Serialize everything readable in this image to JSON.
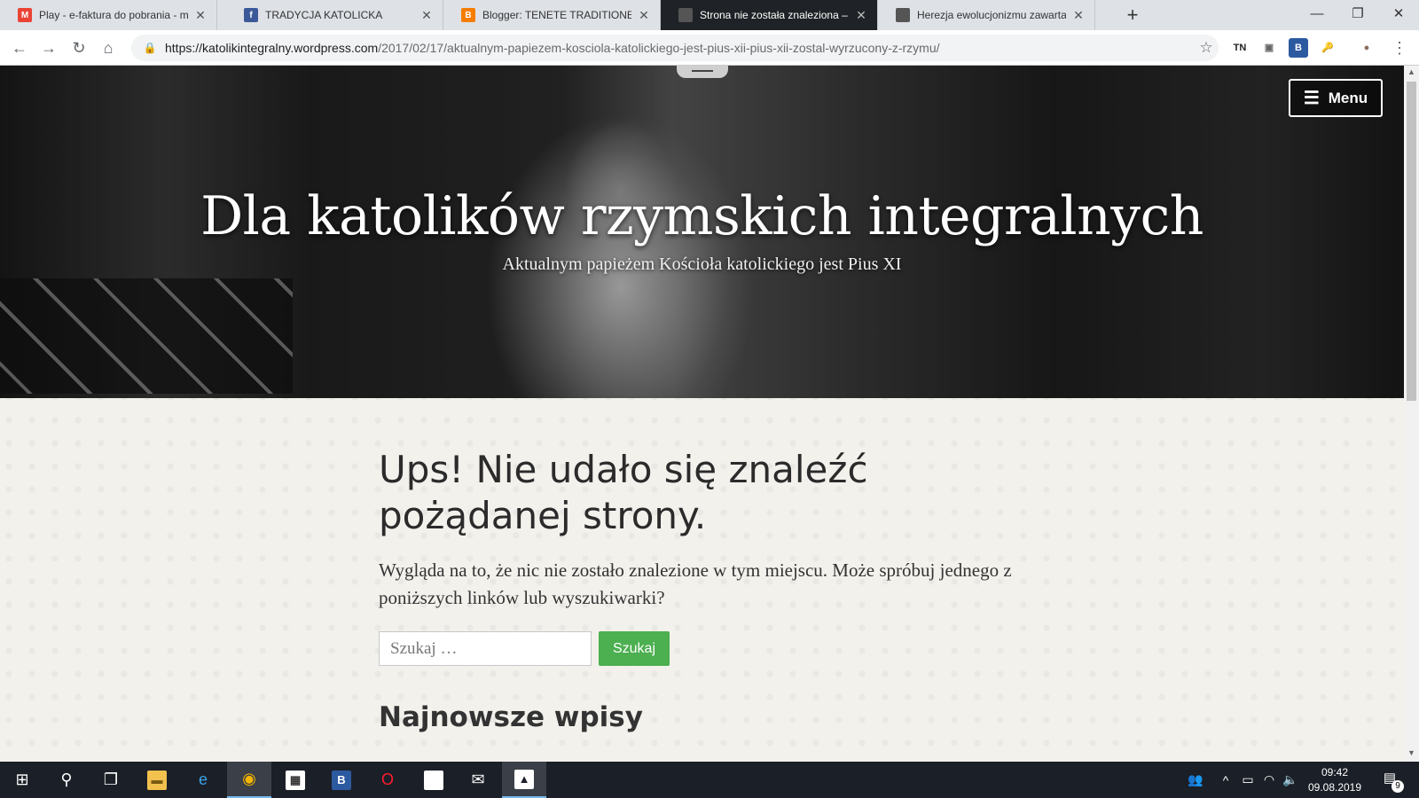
{
  "browser": {
    "tabs": [
      {
        "title": "Play - e-faktura do pobrania - m",
        "favicon": "gmail-icon",
        "favicon_color": "#ea4335",
        "favicon_glyph": "M",
        "active": false
      },
      {
        "title": "TRADYCJA KATOLICKA",
        "favicon": "facebook-icon",
        "favicon_color": "#3b5998",
        "favicon_glyph": "f",
        "active": false
      },
      {
        "title": "Blogger: TENETE TRADITIONES -",
        "favicon": "blogger-icon",
        "favicon_color": "#f57d00",
        "favicon_glyph": "B",
        "active": false
      },
      {
        "title": "Strona nie została znaleziona – D",
        "favicon": "site-icon",
        "favicon_color": "#555555",
        "favicon_glyph": "",
        "active": true
      },
      {
        "title": "Herezja ewolucjonizmu zawarta w",
        "favicon": "site-icon",
        "favicon_color": "#555555",
        "favicon_glyph": "",
        "active": false
      }
    ],
    "new_tab_glyph": "+",
    "window_controls": {
      "minimize": "—",
      "restore": "❐",
      "close": "✕"
    },
    "url_host": "https://katolikintegralny.wordpress.com",
    "url_path": "/2017/02/17/aktualnym-papiezem-kosciola-katolickiego-jest-pius-xii-pius-xii-zostal-wyrzucony-z-rzymu/",
    "extensions": [
      {
        "name": "tn-extension-icon",
        "label": "TN",
        "bg": "#ffffff",
        "fg": "#222222"
      },
      {
        "name": "image-extension-icon",
        "label": "▣",
        "bg": "#ffffff",
        "fg": "#666666"
      },
      {
        "name": "b-extension-icon",
        "label": "B",
        "bg": "#2c5aa0",
        "fg": "#ffffff"
      },
      {
        "name": "key-extension-icon",
        "label": "🔑",
        "bg": "#ffffff",
        "fg": "#e8a000"
      },
      {
        "name": "profile-avatar-icon",
        "label": "●",
        "bg": "#ffffff",
        "fg": "#8a6d5a"
      }
    ]
  },
  "page": {
    "menu_label": "Menu",
    "site_title": "Dla katolików rzymskich integralnych",
    "site_description": "Aktualnym papieżem Kościoła katolickiego jest Pius XI",
    "error_title": "Ups! Nie udało się znaleźć pożądanej strony.",
    "error_text": "Wygląda na to, że nic nie zostało znalezione w tym miejscu. Może spróbuj jednego z poniższych linków lub wyszukiwarki?",
    "search_placeholder": "Szukaj …",
    "search_button": "Szukaj",
    "recent_posts_title": "Najnowsze wpisy"
  },
  "taskbar": {
    "apps": [
      {
        "name": "start-button",
        "glyph": "⊞",
        "bg": "",
        "fg": "#ffffff",
        "active": false
      },
      {
        "name": "search-icon",
        "glyph": "⚲",
        "bg": "",
        "fg": "#ffffff",
        "active": false
      },
      {
        "name": "task-view-icon",
        "glyph": "❐",
        "bg": "",
        "fg": "#ffffff",
        "active": false
      },
      {
        "name": "file-explorer-icon",
        "glyph": "▬",
        "bg": "#f2c14e",
        "fg": "#7a5a10",
        "active": false
      },
      {
        "name": "edge-icon",
        "glyph": "e",
        "bg": "",
        "fg": "#3ba3e8",
        "active": false
      },
      {
        "name": "chrome-icon",
        "glyph": "◉",
        "bg": "",
        "fg": "#f4b400",
        "active": true
      },
      {
        "name": "store-icon",
        "glyph": "▦",
        "bg": "#ffffff",
        "fg": "#333333",
        "active": false
      },
      {
        "name": "b-app-icon",
        "glyph": "B",
        "bg": "#2c5aa0",
        "fg": "#ffffff",
        "active": false
      },
      {
        "name": "opera-icon",
        "glyph": "O",
        "bg": "",
        "fg": "#ff1b2d",
        "active": false
      },
      {
        "name": "notepad-icon",
        "glyph": "▯",
        "bg": "#ffffff",
        "fg": "#ffffff",
        "active": false
      },
      {
        "name": "mail-icon",
        "glyph": "✉",
        "bg": "",
        "fg": "#ffffff",
        "active": false
      },
      {
        "name": "photos-icon",
        "glyph": "▲",
        "bg": "#ffffff",
        "fg": "#1b1f27",
        "active": true
      }
    ],
    "time": "09:42",
    "date": "09.08.2019",
    "notification_count": "9"
  }
}
